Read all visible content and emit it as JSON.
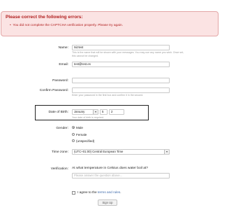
{
  "errors": {
    "title": "Please correct the following errors:",
    "items": [
      "You did not complete the CAPTCHA verification properly. Please try again."
    ]
  },
  "form": {
    "name": {
      "label": "Name:",
      "value": "tsiztest",
      "hint_line1": "This is the name that will be shown with your messages. You may use any name you wish. Once set,",
      "hint_line2": "this cannot be changed."
    },
    "email": {
      "label": "Email:",
      "value": "test@test.es"
    },
    "password": {
      "label": "Password:",
      "value": ""
    },
    "confirm_password": {
      "label": "Confirm Password:",
      "value": "",
      "hint": "Enter your password in the first box and confirm it in the second."
    },
    "dob": {
      "label": "Date of Birth:",
      "month": "January",
      "day": "5",
      "year": "2",
      "hint": "Your date of birth is required.",
      "arrow_icon": "chevron-down-icon"
    },
    "gender": {
      "label": "Gender:",
      "options": [
        "Male",
        "Female",
        "(unspecified)"
      ],
      "selected": "Male"
    },
    "timezone": {
      "label": "Time zone:",
      "value": "(UTC+01:00) Central European Time"
    },
    "verification": {
      "label": "Verification:",
      "question": "At what temperature in Celsius does water boil at?",
      "placeholder": "Please answer the question above..."
    },
    "agree": {
      "prefix": "I agree to the",
      "link": "terms and rules",
      "suffix": ".",
      "checked": false
    },
    "submit_label": "Sign Up"
  },
  "colors": {
    "error_text": "#b01e1e",
    "error_bg": "#fbe3e3",
    "link": "#3a67a9"
  }
}
